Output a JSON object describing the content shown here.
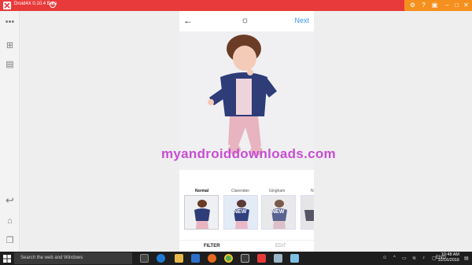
{
  "window": {
    "title": "Droid4X 0.10.4 Beta",
    "colors": {
      "titlebar_red": "#e83a3a",
      "titlebar_orange": "#f5901f"
    }
  },
  "toolbar_left": {
    "tools": [
      "more-icon",
      "layout-icon",
      "apk-icon",
      "back-icon",
      "home-icon",
      "recent-icon"
    ]
  },
  "app": {
    "next_label": "Next",
    "filters": [
      {
        "name": "Normal",
        "active": true
      },
      {
        "name": "Clarendon",
        "active": false
      },
      {
        "name": "Gingham",
        "active": false
      }
    ],
    "thumb_badges": [
      "NEW",
      "NEW"
    ],
    "tabs": {
      "filter": "FILTER",
      "edit": "EDIT"
    },
    "accent": "#3897f0"
  },
  "watermark": "myandroiddownloads.com",
  "taskbar": {
    "search_placeholder": "Search the web and Windows",
    "language": "ENG",
    "time": "10:48 AM",
    "date": "10/16/2016"
  }
}
